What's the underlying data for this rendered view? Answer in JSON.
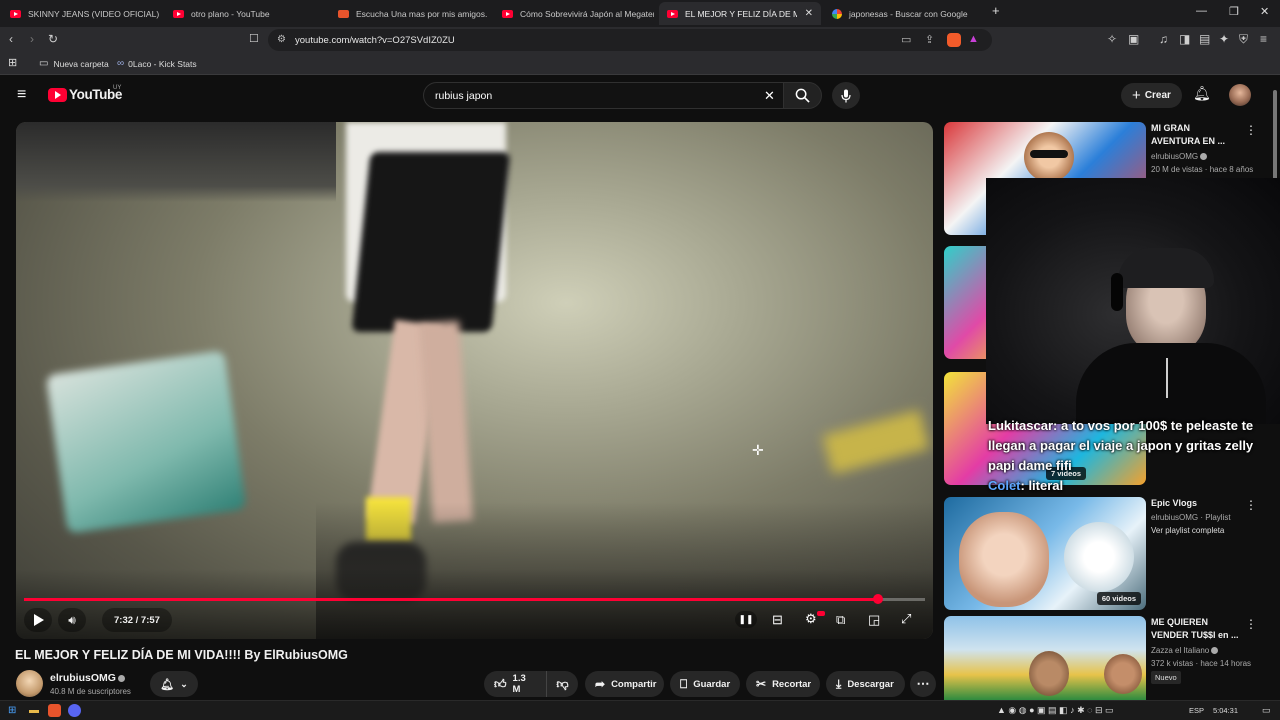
{
  "browser": {
    "tabs": [
      {
        "title": "SKINNY JEANS (VIDEO OFICIAL) - Yo",
        "icon": "youtube-icon"
      },
      {
        "title": "otro plano - YouTube",
        "icon": "youtube-icon"
      },
      {
        "title": "Escucha Una mas por mis amigos. Pr",
        "icon": "soundcloud-icon"
      },
      {
        "title": "Cómo Sobrevivirá Japón al Megaterr",
        "icon": "youtube-icon"
      },
      {
        "title": "EL MEJOR Y FELIZ DÍA DE MI VID",
        "icon": "youtube-icon",
        "active": true
      },
      {
        "title": "japonesas - Buscar con Google",
        "icon": "google-icon"
      }
    ],
    "new_tab": "+",
    "url": "youtube.com/watch?v=O27SVdIZ0ZU",
    "bookmarks": [
      {
        "label": "Nueva carpeta",
        "icon": "folder-icon"
      },
      {
        "label": "0Laco - Kick Stats",
        "icon": "link-icon"
      }
    ]
  },
  "youtube": {
    "logo_text": "YouTube",
    "region": "UY",
    "search_value": "rubius japon",
    "create_label": "Crear"
  },
  "player": {
    "time": "7:32 / 7:57",
    "progress_fraction": 0.948,
    "accent": "#ff0033"
  },
  "video": {
    "title": "EL MEJOR Y FELIZ DÍA DE MI VIDA!!!! By ElRubiusOMG",
    "channel": "elrubiusOMG",
    "subscribers": "40.8 M de suscriptores",
    "likes": "1.3 M",
    "share": "Compartir",
    "save": "Guardar",
    "clip": "Recortar",
    "download": "Descargar"
  },
  "sidebar": [
    {
      "title": "MI GRAN AVENTURA EN ...",
      "channel": "elrubiusOMG",
      "meta": "20 M de vistas · hace 8 años",
      "badge": ""
    },
    {
      "title": "",
      "channel": "",
      "meta": "",
      "badge": ""
    },
    {
      "title": "",
      "channel": "",
      "meta": "",
      "badge": "7 videos"
    },
    {
      "title": "Epic Vlogs",
      "channel": "elrubiusOMG · Playlist",
      "meta": "Ver playlist completa",
      "badge": "60 videos"
    },
    {
      "title": "ME QUIEREN VENDER TU$$I en ...",
      "channel": "Zazza el Italiano",
      "meta": "372 k vistas · hace 14 horas",
      "badge": "",
      "tag": "Nuevo"
    }
  ],
  "overlay": {
    "message": "Lukitascar: a to vos por 100$ te peleaste te llegan a pagar el viaje a japon y gritas zelly papi dame fifi",
    "second_user": "Colet",
    "second_message": ": literal"
  },
  "taskbar": {
    "lang": "ESP",
    "clock": "5:04:31"
  }
}
